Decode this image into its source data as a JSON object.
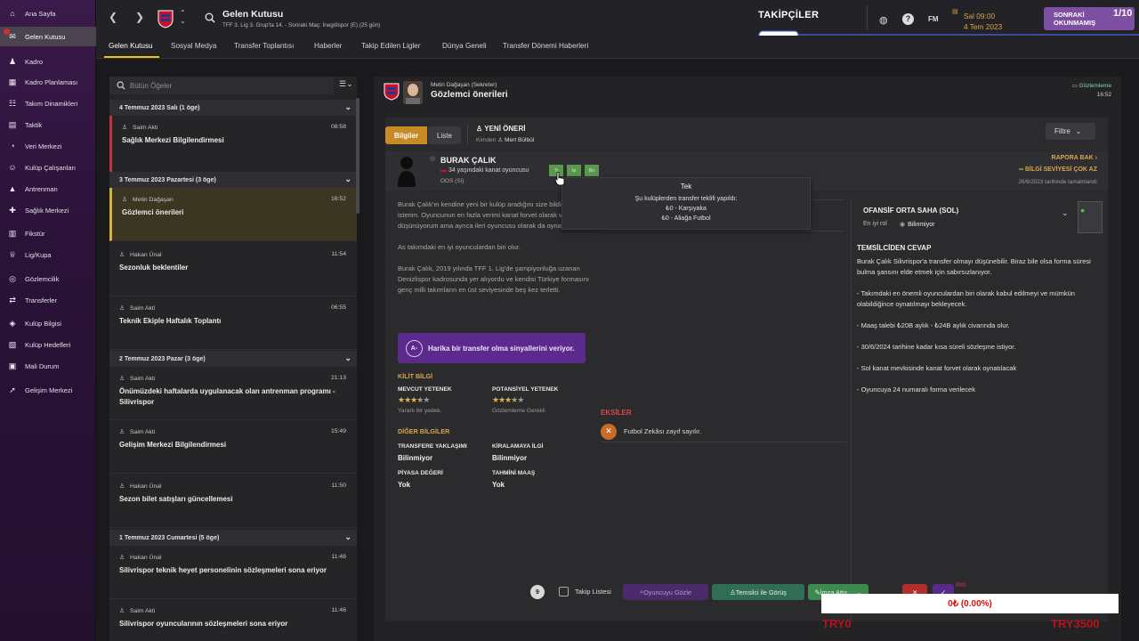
{
  "sidebar": {
    "items": [
      {
        "label": "Ana Sayfa",
        "icon": "home-icon",
        "glyph": "⌂"
      },
      {
        "label": "Gelen Kutusu",
        "icon": "inbox-icon",
        "glyph": "✉"
      },
      {
        "label": "Kadro",
        "icon": "squad-icon",
        "glyph": "♟"
      },
      {
        "label": "Kadro Planlaması",
        "icon": "squad-planner-icon",
        "glyph": "▦"
      },
      {
        "label": "Takım Dinamikleri",
        "icon": "dynamics-icon",
        "glyph": "☷"
      },
      {
        "label": "Taktik",
        "icon": "tactics-icon",
        "glyph": "▤"
      },
      {
        "label": "Veri Merkezi",
        "icon": "data-hub-icon",
        "glyph": "◔"
      },
      {
        "label": "Kulüp Çalışanları",
        "icon": "staff-icon",
        "glyph": "☺"
      },
      {
        "label": "Antrenman",
        "icon": "training-icon",
        "glyph": "▲"
      },
      {
        "label": "Sağlık Merkezi",
        "icon": "medical-icon",
        "glyph": "✚"
      },
      {
        "label": "Fikstür",
        "icon": "fixtures-icon",
        "glyph": "▥"
      },
      {
        "label": "Lig/Kupa",
        "icon": "trophy-icon",
        "glyph": "♕"
      },
      {
        "label": "Gözlemcilik",
        "icon": "scouting-icon",
        "glyph": "◎"
      },
      {
        "label": "Transferler",
        "icon": "transfers-icon",
        "glyph": "⇄"
      },
      {
        "label": "Kulüp Bilgisi",
        "icon": "club-info-icon",
        "glyph": "◈"
      },
      {
        "label": "Kulüp Hedefleri",
        "icon": "club-vision-icon",
        "glyph": "▧"
      },
      {
        "label": "Mali Durum",
        "icon": "finances-icon",
        "glyph": "▣"
      },
      {
        "label": "Gelişim Merkezi",
        "icon": "dev-centre-icon",
        "glyph": "➚"
      }
    ],
    "active_index": 1,
    "badge_count": "1"
  },
  "topbar": {
    "title": "Gelen Kutusu",
    "subtitle": "TFF 3. Lig 3. Grup'ta 14. - Sonraki Maç: İnegölspor (E) (25 gün)",
    "followers": "TAKİPÇİLER",
    "fm_label": "FM",
    "day_time": "Sal 09:00",
    "date": "4 Tem 2023",
    "continue_label_1": "SONRAKİ",
    "continue_label_2": "OKUNMAMIŞ",
    "continue_count": "1/10"
  },
  "subtabs": [
    "Gelen Kutusu",
    "Sosyal Medya",
    "Transfer Toplantısı",
    "Haberler",
    "Takip Edilen Ligler",
    "Dünya Geneli",
    "Transfer Dönemi Haberleri"
  ],
  "inbox": {
    "search_placeholder": "Bütün Öğeler",
    "groups": [
      {
        "label": "4 Temmuz 2023 Salı (1 öge)"
      },
      {
        "label": "3 Temmuz 2023 Pazartesi (3 öge)"
      },
      {
        "label": "2 Temmuz 2023 Pazar (3 öge)"
      },
      {
        "label": "1 Temmuz 2023 Cumartesi (5 öge)"
      }
    ],
    "messages": [
      {
        "from": "Saim Akti",
        "time": "08:58",
        "subject": "Sağlık Merkezi Bilgilendirmesi"
      },
      {
        "from": "Metin Dağaşan",
        "time": "16:52",
        "subject": "Gözlemci önerileri"
      },
      {
        "from": "Hakan Ünal",
        "time": "11:54",
        "subject": "Sezonluk beklentiler"
      },
      {
        "from": "Saim Akti",
        "time": "06:55",
        "subject": "Teknik Ekiple Haftalık Toplantı"
      },
      {
        "from": "Saim Akti",
        "time": "21:13",
        "subject": "Önümüzdeki haftalarda uygulanacak olan antrenman programı - Silivrispor"
      },
      {
        "from": "Saim Akti",
        "time": "15:49",
        "subject": "Gelişim Merkezi Bilgilendirmesi"
      },
      {
        "from": "Hakan Ünal",
        "time": "11:50",
        "subject": "Sezon bilet satışları güncellemesi"
      },
      {
        "from": "Hakan Ünal",
        "time": "11:48",
        "subject": "Silivrispor teknik heyet personelinin sözleşmeleri sona eriyor"
      },
      {
        "from": "Saim Akti",
        "time": "11:46",
        "subject": "Silivrispor oyuncularının sözleşmeleri sona eriyor"
      }
    ]
  },
  "message": {
    "sender": "Metin Dağaşan (Sekreter)",
    "title": "Gözlemci önerileri",
    "tag": "Gözlemleme",
    "time": "16:52",
    "seg_info": "Bilgiler",
    "seg_list": "Liste",
    "new_rec": "YENİ ÖNERİ",
    "from_label": "Kimden",
    "from_name": "Mert Bülbül",
    "filter": "Filtre",
    "player": {
      "name": "BURAK ÇALIK",
      "desc": "34 yaşındaki kanat oyuncusu",
      "position": "OOS (Sl)",
      "pills": [
        "Tr",
        "Ia",
        "Bo"
      ],
      "report_link": "RAPORA BAK",
      "knowledge": "BİLGİ SEVİYESİ ÇOK AZ",
      "completed": "26/6/2023 tarihinde tamamlandı"
    },
    "paragraphs": [
      "Burak Çalık'ın kendine yeni bir kulüp aradığını size bildirmek isterim. Oyuncunun en fazla verimi kanat forvet olarak verdiğini düşünüyorum ama ayrıca ileri oyuncusu olarak da oynayabiliyor.",
      "As takımdaki en iyi oyunculardan biri olur.",
      "Burak Çalık, 2019 yılında TFF 1. Lig'de şampiyonluğa uzanan Denizlispor kadrosunda yer alıyordu ve kendisi Türkiye formasını genç milli takımların en üst seviyesinde beş kez terletti."
    ],
    "signal_icon": "A-",
    "signal": "Harika bir transfer olma sinyallerini veriyor.",
    "key_info": "KİLİT BİLGİ",
    "current_ability": "MEVCUT YETENEK",
    "current_stars": 3.5,
    "current_note": "Yararlı bir yedek.",
    "potential_ability": "POTANSİYEL YETENEK",
    "potential_stars": 3.5,
    "potential_note": "Gözlemleme Gerekli",
    "other_info": "DİĞER BİLGİLER",
    "transfer_approach_l": "TRANSFERE YAKLAŞIMI",
    "transfer_approach_v": "Bilinmiyor",
    "loan_l": "KİRALAMAYA İLGİ",
    "loan_v": "Bilinmiyor",
    "value_l": "PİYASA DEĞERİ",
    "value_v": "Yok",
    "wage_l": "TAHMİNİ MAAŞ",
    "wage_v": "Yok",
    "weak_h": "EKSİLER",
    "weak_item": "Futbol Zekâsı zayıf sayılır.",
    "pos_name": "OFANSİF ORTA SAHA (SOL)",
    "best_role_l": "En iyi rol",
    "best_role_v": "Bilinmiyor",
    "agent_h": "TEMSİLCİDEN CEVAP",
    "agent_lines": [
      "Burak Çalık Silivrispor'a transfer olmayı düşünebilir. Biraz bile olsa forma süresi bulma şansını elde etmek için sabırsızlanıyor.",
      "- Takımdaki en önemli oyunculardan biri olarak kabul edilmeyi ve mümkün olabildiğince oynatılmayı bekleyecek.",
      "- Maaş talebi ₺20B aylık - ₺24B aylık civarında olur.",
      "- 30/6/2024 tarihine kadar kısa süreli sözleşme istiyor.",
      "- Sol kanat mevkisinde kanat forvet olarak oynatılacak",
      "- Oyuncuya 24 numaralı forma verilecek"
    ]
  },
  "tooltip": {
    "title": "Tek",
    "lines": [
      "Şu kulüplerden transfer teklifi yapıldı:",
      "₺0 - Karşıyaka",
      "₺0 - Aliağa Futbol"
    ]
  },
  "actions": {
    "count": "9",
    "watch": "Takip Listesi",
    "scout": "Oyuncuyu Gözle",
    "agent": "Temsilci ile Görüş",
    "sign": "İmza Attır",
    "overflow": "Bitti"
  },
  "overlay": {
    "box": "0₺ (0.00%)",
    "left": "TRY0",
    "right": "TRY3500"
  },
  "colors": {
    "accent": "#d9a64b",
    "purple": "#5c2a8c",
    "green": "#3d8a4e"
  }
}
